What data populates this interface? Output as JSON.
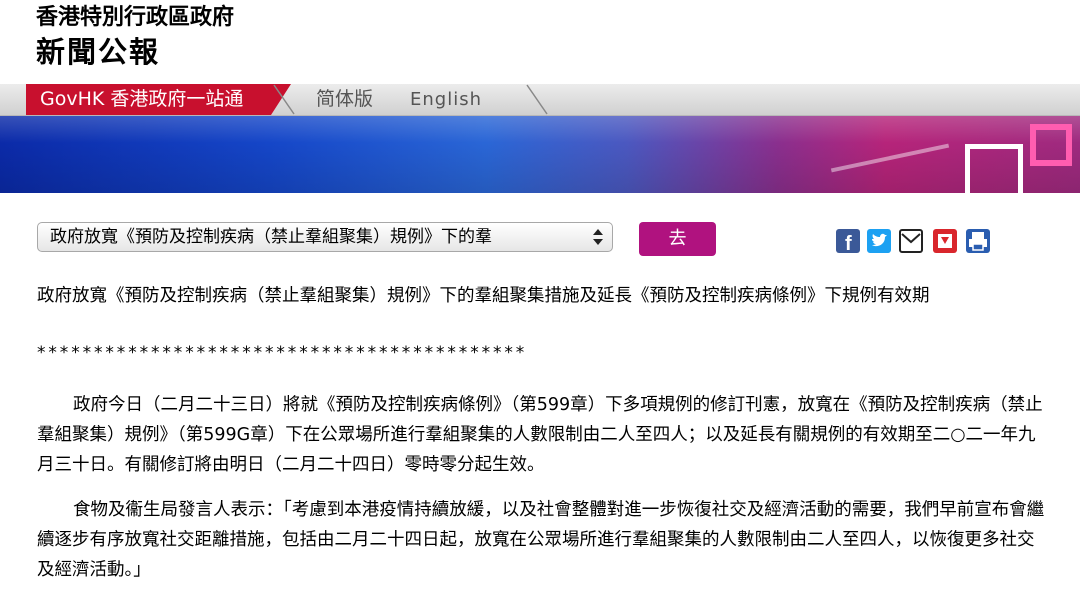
{
  "header": {
    "org": "香港特別行政區政府",
    "dept": "新聞公報"
  },
  "nav": {
    "govhk": "GovHK 香港政府一站通",
    "simplified": "简体版",
    "english": "English"
  },
  "controls": {
    "selected_option": "政府放寬《預防及控制疾病（禁止羣組聚集）規例》下的羣",
    "go_label": "去"
  },
  "share_icons": [
    "facebook-icon",
    "twitter-icon",
    "email-icon",
    "bookmark-icon",
    "print-icon"
  ],
  "colors": {
    "nav_red": "#c8102e",
    "go_button": "#b0127f",
    "facebook": "#3b5998",
    "twitter": "#1da1f2",
    "bookmark": "#d9262c",
    "print": "#2a5db0"
  },
  "article": {
    "title": "政府放寬《預防及控制疾病（禁止羣組聚集）規例》下的羣組聚集措施及延長《預防及控制疾病條例》下規例有效期",
    "separator": "*******************************************",
    "para1": "政府今日（二月二十三日）將就《預防及控制疾病條例》（第599章）下多項規例的修訂刊憲，放寬在《預防及控制疾病（禁止羣組聚集）規例》（第599G章）下在公眾場所進行羣組聚集的人數限制由二人至四人；以及延長有關規例的有效期至二○二一年九月三十日。有關修訂將由明日（二月二十四日）零時零分起生效。",
    "para2": "食物及衞生局發言人表示：「考慮到本港疫情持續放緩，以及社會整體對進一步恢復社交及經濟活動的需要，我們早前宣布會繼續逐步有序放寬社交距離措施，包括由二月二十四日起，放寬在公眾場所進行羣組聚集的人數限制由二人至四人，以恢復更多社交及經濟活動。」"
  }
}
